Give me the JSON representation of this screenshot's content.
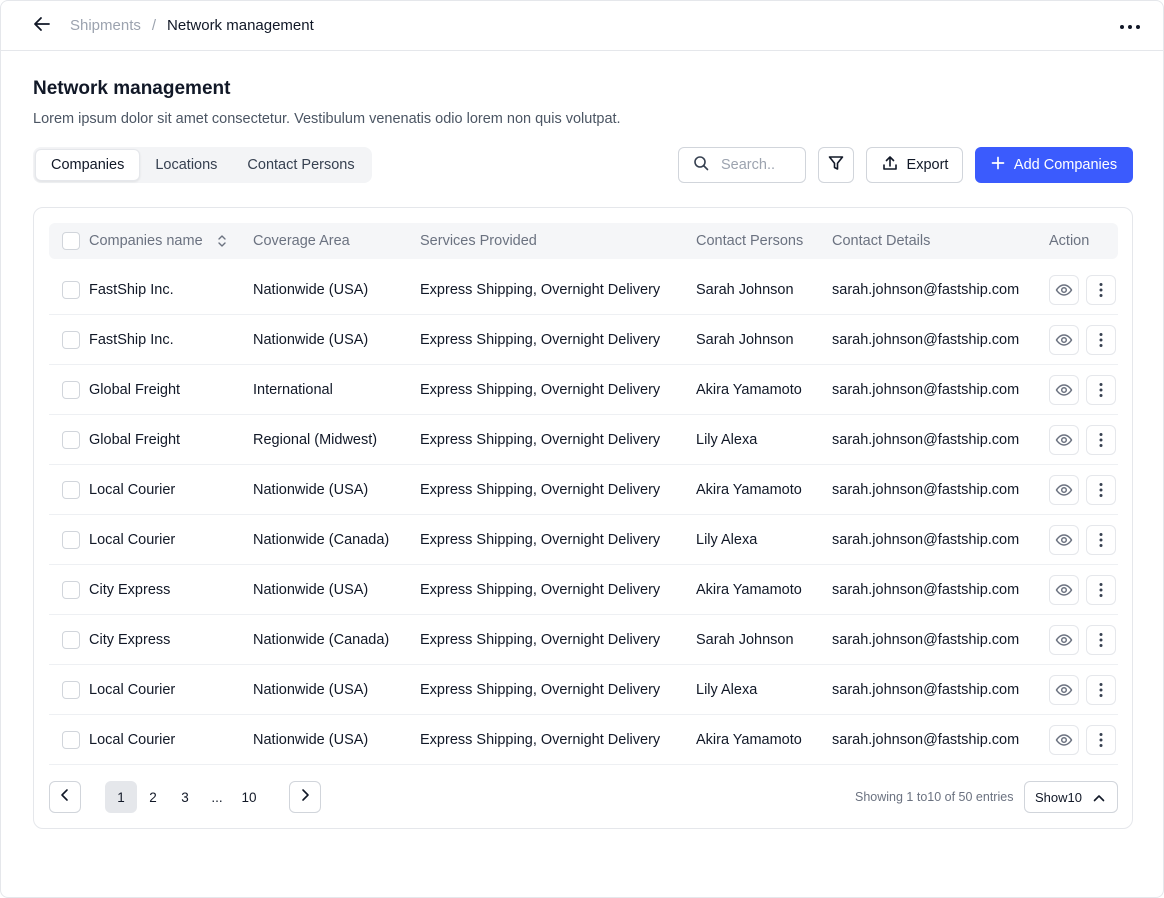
{
  "breadcrumb": {
    "parent": "Shipments",
    "separator": "/",
    "current": "Network management"
  },
  "header": {
    "title": "Network management",
    "description": "Lorem ipsum dolor sit amet consectetur. Vestibulum venenatis odio lorem non quis volutpat."
  },
  "tabs": [
    {
      "label": "Companies",
      "active": true
    },
    {
      "label": "Locations",
      "active": false
    },
    {
      "label": "Contact Persons",
      "active": false
    }
  ],
  "toolbar": {
    "search_placeholder": "Search..",
    "export_label": "Export",
    "add_label": "Add Companies",
    "accent_color": "#3b5bfd"
  },
  "table": {
    "columns": [
      "Companies name",
      "Coverage Area",
      "Services Provided",
      "Contact Persons",
      "Contact Details",
      "Action"
    ],
    "rows": [
      {
        "company": "FastShip Inc.",
        "area": "Nationwide (USA)",
        "services": "Express Shipping, Overnight Delivery",
        "contact": "Sarah Johnson",
        "details": "sarah.johnson@fastship.com"
      },
      {
        "company": "FastShip Inc.",
        "area": "Nationwide (USA)",
        "services": "Express Shipping, Overnight Delivery",
        "contact": "Sarah Johnson",
        "details": "sarah.johnson@fastship.com"
      },
      {
        "company": "Global Freight",
        "area": "International",
        "services": "Express Shipping, Overnight Delivery",
        "contact": "Akira Yamamoto",
        "details": "sarah.johnson@fastship.com"
      },
      {
        "company": "Global Freight",
        "area": "Regional (Midwest)",
        "services": "Express Shipping, Overnight Delivery",
        "contact": "Lily Alexa",
        "details": "sarah.johnson@fastship.com"
      },
      {
        "company": "Local Courier",
        "area": "Nationwide (USA)",
        "services": "Express Shipping, Overnight Delivery",
        "contact": "Akira Yamamoto",
        "details": "sarah.johnson@fastship.com"
      },
      {
        "company": "Local Courier",
        "area": "Nationwide (Canada)",
        "services": "Express Shipping, Overnight Delivery",
        "contact": "Lily Alexa",
        "details": "sarah.johnson@fastship.com"
      },
      {
        "company": "City Express",
        "area": "Nationwide (USA)",
        "services": "Express Shipping, Overnight Delivery",
        "contact": "Akira Yamamoto",
        "details": "sarah.johnson@fastship.com"
      },
      {
        "company": "City Express",
        "area": "Nationwide (Canada)",
        "services": "Express Shipping, Overnight Delivery",
        "contact": "Sarah Johnson",
        "details": "sarah.johnson@fastship.com"
      },
      {
        "company": "Local Courier",
        "area": "Nationwide (USA)",
        "services": "Express Shipping, Overnight Delivery",
        "contact": "Lily Alexa",
        "details": "sarah.johnson@fastship.com"
      },
      {
        "company": "Local Courier",
        "area": "Nationwide (USA)",
        "services": "Express Shipping, Overnight Delivery",
        "contact": "Akira Yamamoto",
        "details": "sarah.johnson@fastship.com"
      }
    ]
  },
  "pagination": {
    "pages": [
      "1",
      "2",
      "3",
      "...",
      "10"
    ],
    "current_page": "1",
    "showing_text": "Showing 1 to10 of 50 entries",
    "show_label": "Show10"
  },
  "icons": {
    "back": "arrow-left-icon",
    "more": "more-horizontal-icon",
    "search": "search-icon",
    "filter": "filter-icon",
    "export": "upload-icon",
    "add": "plus-icon",
    "sort": "sort-icon",
    "view": "eye-icon",
    "row_menu": "more-vertical-icon",
    "prev": "chevron-left-icon",
    "next": "chevron-right-icon",
    "select": "chevron-up-icon"
  }
}
